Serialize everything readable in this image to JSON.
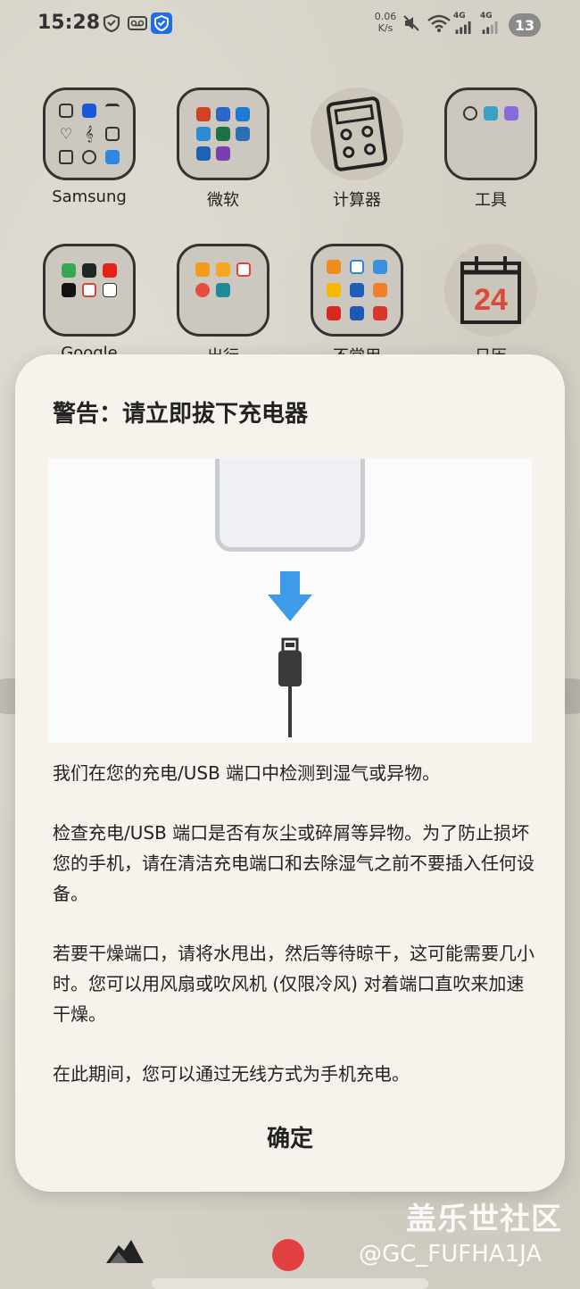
{
  "status_bar": {
    "time": "15:28",
    "net_speed": "0.06",
    "net_unit": "K/s",
    "net_gen_1": "4G",
    "net_gen_2": "4G",
    "notification_count": "13",
    "icons": [
      "shield-outline-icon",
      "voicemail-icon",
      "security-shield-icon",
      "mute-icon",
      "wifi-icon",
      "signal-icon",
      "signal-icon"
    ]
  },
  "home": {
    "apps": [
      {
        "label": "Samsung",
        "type": "folder"
      },
      {
        "label": "微软",
        "type": "folder"
      },
      {
        "label": "计算器",
        "type": "app"
      },
      {
        "label": "工具",
        "type": "folder"
      },
      {
        "label": "Google",
        "type": "folder"
      },
      {
        "label": "出行",
        "type": "folder"
      },
      {
        "label": "不常用",
        "type": "folder"
      },
      {
        "label": "日历",
        "type": "app",
        "day": "24"
      }
    ]
  },
  "dialog": {
    "title": "警告：请立即拔下充电器",
    "paragraphs": [
      "我们在您的充电/USB 端口中检测到湿气或异物。",
      "检查充电/USB 端口是否有灰尘或碎屑等异物。为了防止损坏您的手机，请在清洁充电端口和去除湿气之前不要插入任何设备。",
      "若要干燥端口，请将水甩出，然后等待晾干，这可能需要几小时。您可以用风扇或吹风机 (仅限冷风) 对着端口直吹来加速干燥。",
      "在此期间，您可以通过无线方式为手机充电。"
    ],
    "confirm_label": "确定"
  },
  "watermark": {
    "text": "盖乐世社区",
    "handle": "@GC_FUFHA1JA"
  },
  "colors": {
    "dialog_bg": "#f7f3ec",
    "arrow_blue": "#3d9be9",
    "wallpaper": "#d6d1c6"
  }
}
